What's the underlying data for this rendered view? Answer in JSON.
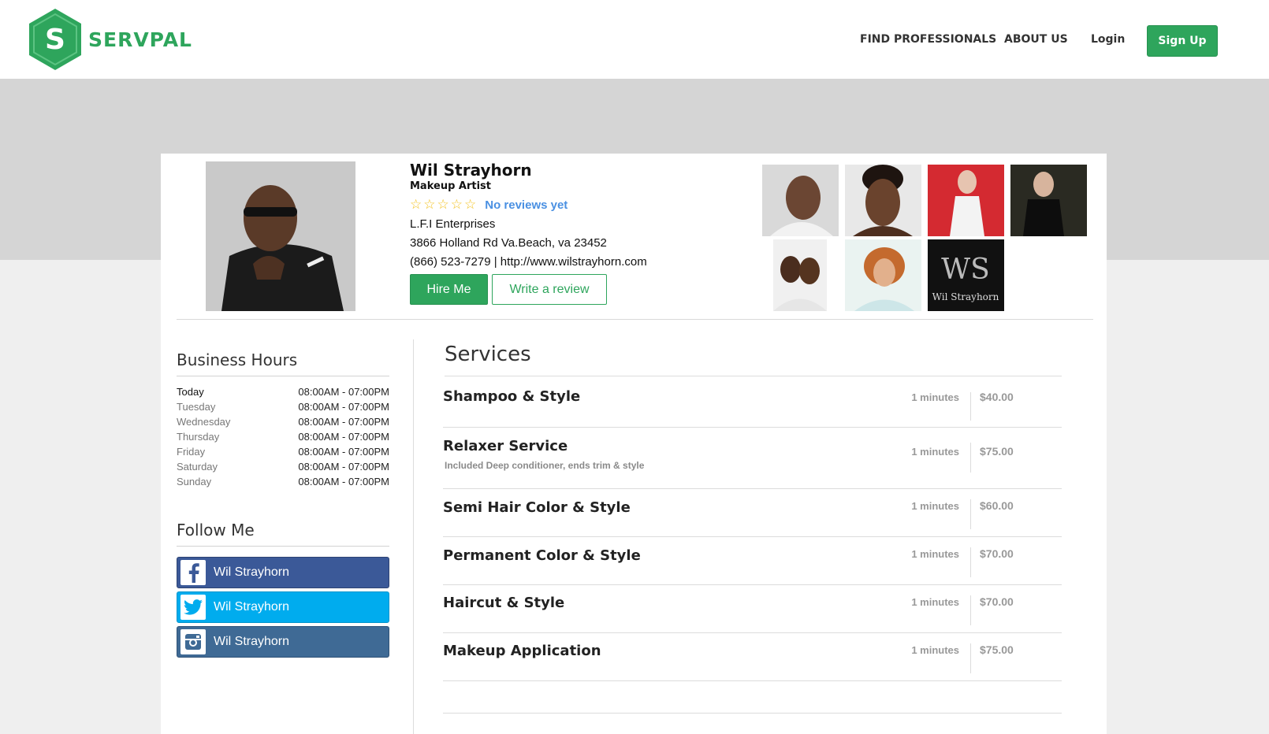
{
  "header": {
    "brand": "SERVPAL",
    "logo_letter": "S",
    "nav": [
      "FIND PROFESSIONALS",
      "ABOUT US",
      "Login"
    ],
    "signup": "Sign Up"
  },
  "profile": {
    "name": "Wil Strayhorn",
    "role": "Makeup Artist",
    "stars": 5,
    "reviews_text": "No reviews yet",
    "company": "L.F.I Enterprises",
    "address": "3866 Holland Rd Va.Beach, va 23452",
    "contact": "(866) 523-7279 | http://www.wilstrayhorn.com",
    "hire_button": "Hire Me",
    "review_button": "Write a review"
  },
  "gallery_caption": "Wil Strayhorn",
  "hours": {
    "title": "Business Hours",
    "rows": [
      {
        "day": "Today",
        "time": "08:00AM - 07:00PM"
      },
      {
        "day": "Tuesday",
        "time": "08:00AM - 07:00PM"
      },
      {
        "day": "Wednesday",
        "time": "08:00AM - 07:00PM"
      },
      {
        "day": "Thursday",
        "time": "08:00AM - 07:00PM"
      },
      {
        "day": "Friday",
        "time": "08:00AM - 07:00PM"
      },
      {
        "day": "Saturday",
        "time": "08:00AM - 07:00PM"
      },
      {
        "day": "Sunday",
        "time": "08:00AM - 07:00PM"
      }
    ]
  },
  "follow": {
    "title": "Follow Me",
    "links": [
      {
        "network": "facebook",
        "label": "Wil Strayhorn",
        "color": "#3b5998"
      },
      {
        "network": "twitter",
        "label": "Wil Strayhorn",
        "color": "#00acee"
      },
      {
        "network": "instagram",
        "label": "Wil Strayhorn",
        "color": "#3f6a95"
      }
    ]
  },
  "services": {
    "title": "Services",
    "items": [
      {
        "name": "Shampoo & Style",
        "desc": "",
        "duration": "1 minutes",
        "price": "$40.00"
      },
      {
        "name": "Relaxer Service",
        "desc": "Included Deep conditioner, ends trim & style",
        "duration": "1 minutes",
        "price": "$75.00"
      },
      {
        "name": "Semi Hair Color & Style",
        "desc": "",
        "duration": "1 minutes",
        "price": "$60.00"
      },
      {
        "name": "Permanent Color & Style",
        "desc": "",
        "duration": "1 minutes",
        "price": "$70.00"
      },
      {
        "name": "Haircut & Style",
        "desc": "",
        "duration": "1 minutes",
        "price": "$70.00"
      },
      {
        "name": "Makeup Application",
        "desc": "",
        "duration": "1 minutes",
        "price": "$75.00"
      }
    ]
  },
  "colors": {
    "brand_green": "#2ea55c",
    "link_blue": "#4a90e2",
    "star_yellow": "#f3c21f"
  }
}
